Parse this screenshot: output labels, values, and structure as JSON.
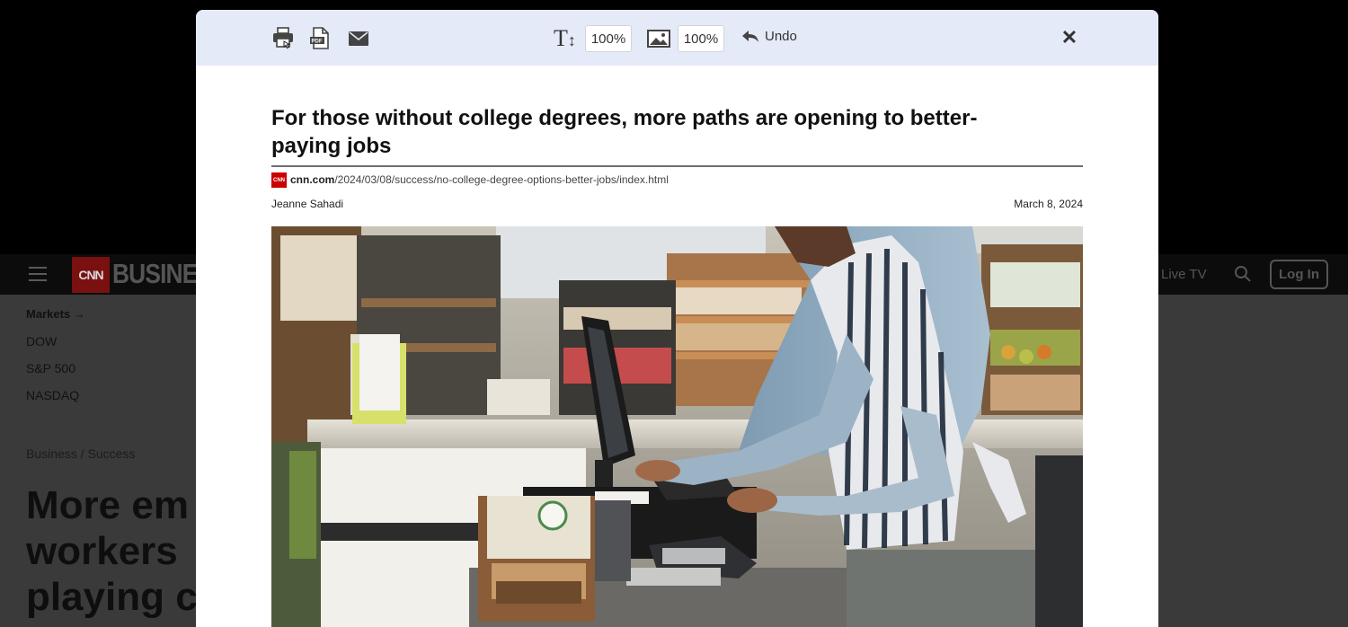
{
  "background": {
    "logo_text": "CNN",
    "brand_text": "BUSINESS",
    "live_tv": "Live TV",
    "login": "Log In",
    "markets": {
      "title": "Markets →",
      "items": [
        "DOW",
        "S&P 500",
        "NASDAQ"
      ]
    },
    "breadcrumb": "Business  /  Success",
    "headline": "More em\nworkers\nplaying c"
  },
  "toolbar": {
    "icons": [
      "print-icon",
      "pdf-icon",
      "email-icon",
      "text-size-icon",
      "image-size-icon",
      "undo-icon",
      "close-icon"
    ],
    "text_size_value": "100%",
    "image_size_value": "100%",
    "undo_label": "Undo"
  },
  "article": {
    "title": "For those without college degrees, more paths are opening to better-paying jobs",
    "source_logo": "CNN",
    "source_domain": "cnn.com",
    "source_path": "/2024/03/08/success/no-college-degree-options-better-jobs/index.html",
    "author": "Jeanne Sahadi",
    "date": "March 8, 2024"
  }
}
